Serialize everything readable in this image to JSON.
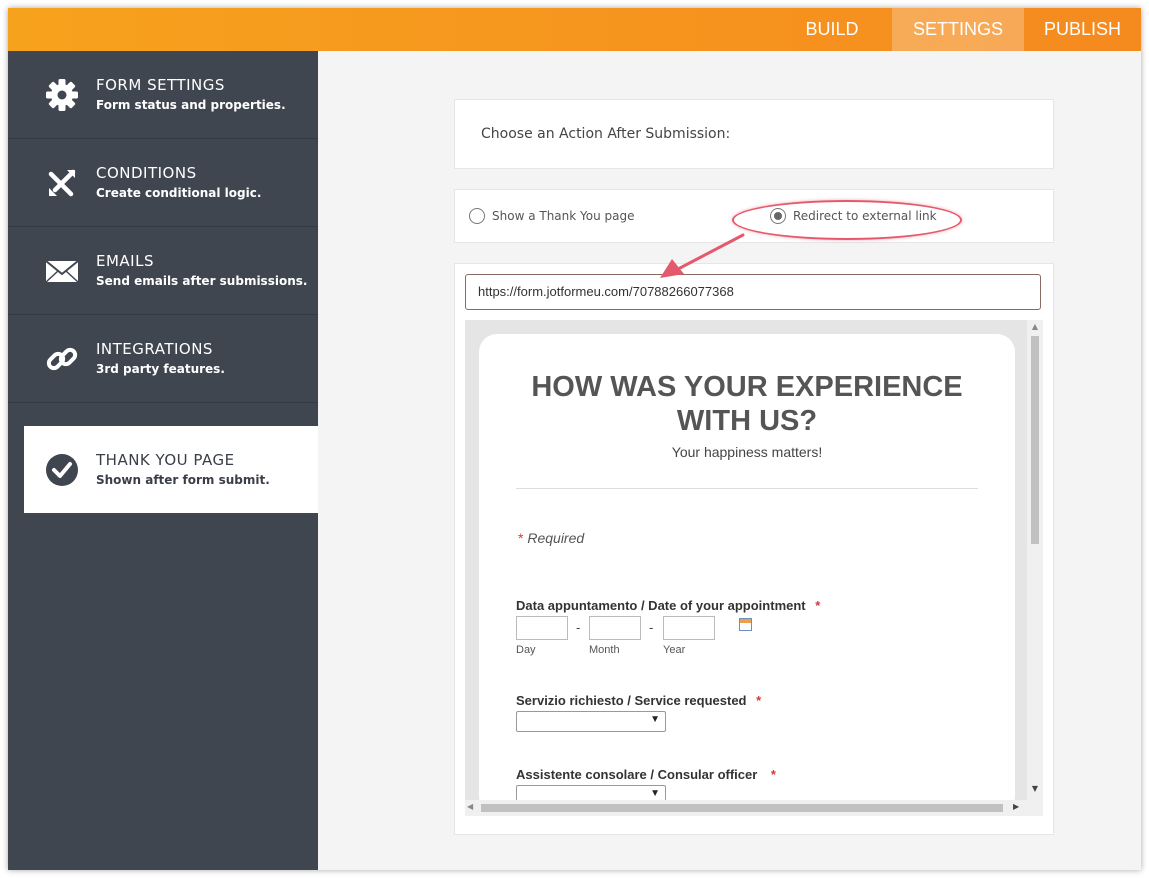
{
  "topnav": {
    "build": "BUILD",
    "settings": "SETTINGS",
    "publish": "PUBLISH"
  },
  "sidebar": {
    "items": [
      {
        "title": "FORM SETTINGS",
        "sub": "Form status and properties.",
        "icon": "gear-icon"
      },
      {
        "title": "CONDITIONS",
        "sub": "Create conditional logic.",
        "icon": "conditions-icon"
      },
      {
        "title": "EMAILS",
        "sub": "Send emails after submissions.",
        "icon": "envelope-icon"
      },
      {
        "title": "INTEGRATIONS",
        "sub": "3rd party features.",
        "icon": "link-icon"
      },
      {
        "title": "THANK YOU PAGE",
        "sub": "Shown after form submit.",
        "icon": "checkmark-icon"
      }
    ],
    "active_index": 4
  },
  "main": {
    "choose_label": "Choose an Action After Submission:",
    "options": [
      {
        "label": "Show a Thank You page",
        "selected": false
      },
      {
        "label": "Redirect to external link",
        "selected": true
      }
    ],
    "url_value": "https://form.jotformeu.com/70788266077368"
  },
  "preview": {
    "title_line1": "HOW WAS YOUR EXPERIENCE",
    "title_line2": "WITH US?",
    "subtitle": "Your happiness matters!",
    "required_star": "*",
    "required_text": "Required",
    "q1_label": "Data appuntamento / Date of your appointment",
    "q1_sep": "-",
    "q1_day": "Day",
    "q1_month": "Month",
    "q1_year": "Year",
    "q2_label": "Servizio richiesto / Service requested",
    "q3_label": "Assistente consolare / Consular officer",
    "caret": "▼"
  },
  "colors": {
    "accent_orange": "#f58a1f",
    "sidebar_bg": "#3f4650",
    "highlight_red": "#e45a6c"
  }
}
